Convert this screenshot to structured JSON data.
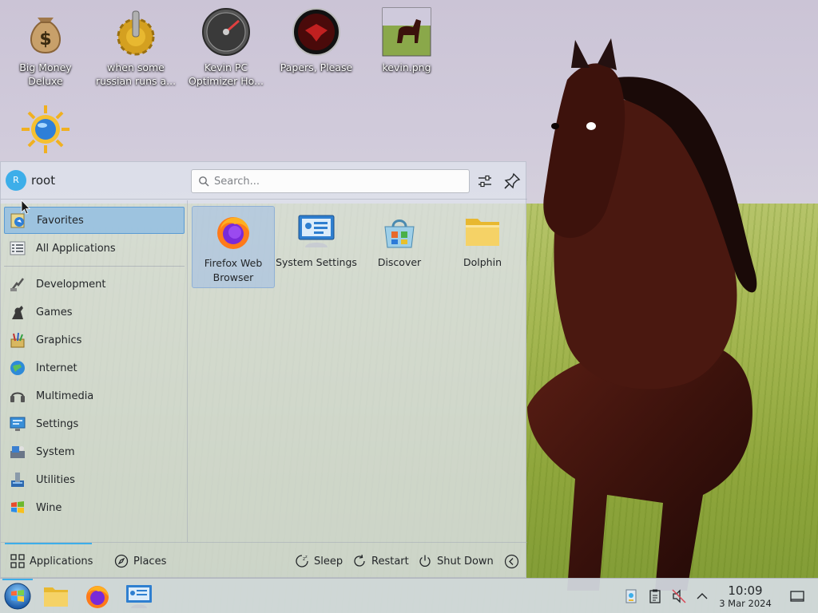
{
  "desktop": {
    "icons": [
      {
        "label": "Big Money Deluxe",
        "icon": "money-bag-icon"
      },
      {
        "label": "when some russian runs a...",
        "icon": "gear-joystick-icon"
      },
      {
        "label": "Kevin PC Optimizer Ho...",
        "icon": "gauge-icon"
      },
      {
        "label": "Papers, Please",
        "icon": "papers-please-emblem-icon"
      },
      {
        "label": "kevin.png",
        "icon": "horse-image-thumbnail"
      },
      {
        "label": "",
        "icon": "sun-globe-icon"
      }
    ]
  },
  "launcher": {
    "user": {
      "initial": "R",
      "name": "root"
    },
    "search": {
      "placeholder": "Search..."
    },
    "toolbar": {
      "configure_icon": "sliders-icon",
      "pin_icon": "pin-icon"
    },
    "categories": [
      {
        "label": "Favorites",
        "icon": "favorites-icon",
        "selected": true
      },
      {
        "label": "All Applications",
        "icon": "grid-list-icon"
      },
      {
        "label": "Development",
        "icon": "development-icon"
      },
      {
        "label": "Games",
        "icon": "games-icon"
      },
      {
        "label": "Graphics",
        "icon": "graphics-icon"
      },
      {
        "label": "Internet",
        "icon": "internet-globe-icon"
      },
      {
        "label": "Multimedia",
        "icon": "multimedia-icon"
      },
      {
        "label": "Settings",
        "icon": "settings-icon"
      },
      {
        "label": "System",
        "icon": "system-icon"
      },
      {
        "label": "Utilities",
        "icon": "utilities-icon"
      },
      {
        "label": "Wine",
        "icon": "wine-windows-icon"
      }
    ],
    "favorites": [
      {
        "label": "Firefox Web Browser",
        "icon": "firefox-icon",
        "selected": true
      },
      {
        "label": "System Settings",
        "icon": "system-settings-icon"
      },
      {
        "label": "Discover",
        "icon": "discover-icon"
      },
      {
        "label": "Dolphin",
        "icon": "folder-icon"
      }
    ],
    "bottom": {
      "tabs": [
        {
          "label": "Applications",
          "icon": "grid-icon",
          "active": true
        },
        {
          "label": "Places",
          "icon": "compass-icon"
        }
      ],
      "actions": [
        {
          "label": "Sleep",
          "icon": "sleep-icon"
        },
        {
          "label": "Restart",
          "icon": "restart-icon"
        },
        {
          "label": "Shut Down",
          "icon": "power-icon"
        }
      ],
      "more_icon": "chevron-left-circle-icon"
    }
  },
  "taskbar": {
    "start_icon": "windows-start-orb-icon",
    "tasks": [
      {
        "icon": "folder-icon"
      },
      {
        "icon": "firefox-icon"
      },
      {
        "icon": "system-settings-icon"
      }
    ],
    "tray": [
      "vault-icon",
      "clipboard-icon",
      "volume-muted-icon",
      "chevron-up-icon"
    ],
    "clock": {
      "time": "10:09",
      "date": "3 Mar 2024"
    },
    "show_desktop_icon": "show-desktop-icon"
  },
  "colors": {
    "accent": "#3daee9",
    "selection": "#93bee2"
  }
}
